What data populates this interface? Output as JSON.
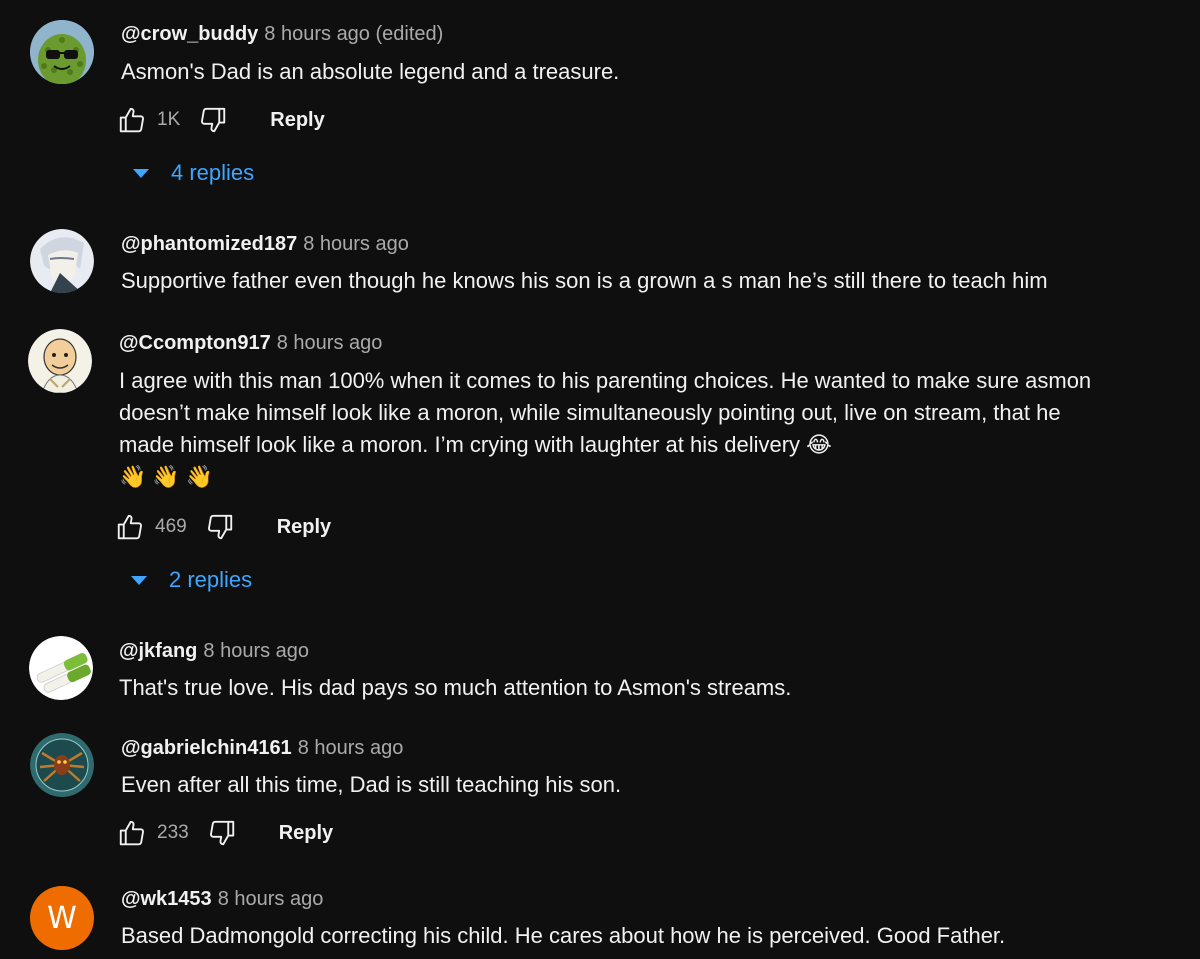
{
  "comments": [
    {
      "handle": "@crow_buddy",
      "time": "8 hours ago (edited)",
      "text": "Asmon's Dad is an absolute legend and a treasure.",
      "likes": "1K",
      "reply_label": "Reply",
      "replies": "4 replies",
      "avatar_icon": "cactus-sunglasses-avatar"
    },
    {
      "handle": "@phantomized187",
      "time": "8 hours ago",
      "text": "Supportive father even though he knows his son is a grown a  s man he’s still there to teach him",
      "avatar_icon": "anime-character-avatar"
    },
    {
      "handle": "@Ccompton917",
      "time": "8 hours ago",
      "text_lines": [
        "I agree with this man 100% when it comes to his parenting choices. He wanted to make sure asmon",
        "doesn’t make himself look like a moron, while simultaneously pointing out, live on stream, that he",
        "made himself look like a moron. I’m crying with laughter at his delivery 😂"
      ],
      "emoji_line": "👋👋👋",
      "likes": "469",
      "reply_label": "Reply",
      "replies": "2 replies",
      "avatar_icon": "bald-cartoon-man-avatar"
    },
    {
      "handle": "@jkfang",
      "time": "8 hours ago",
      "text": "That's true love.  His dad pays so much attention to Asmon's streams.",
      "avatar_icon": "green-onion-avatar"
    },
    {
      "handle": "@gabrielchin4161",
      "time": "8 hours ago",
      "text": "Even after all this time, Dad is still teaching his son.",
      "likes": "233",
      "reply_label": "Reply",
      "avatar_icon": "spider-emblem-avatar"
    },
    {
      "handle": "@wk1453",
      "time": "8 hours ago",
      "text": "Based Dadmongold correcting his child. He cares about how he is perceived. Good Father.",
      "avatar_letter": "W",
      "avatar_color": "#ef6c00"
    }
  ],
  "colors": {
    "background": "#0f0f0f",
    "link": "#3ea6ff",
    "muted": "#aaaaaa"
  }
}
